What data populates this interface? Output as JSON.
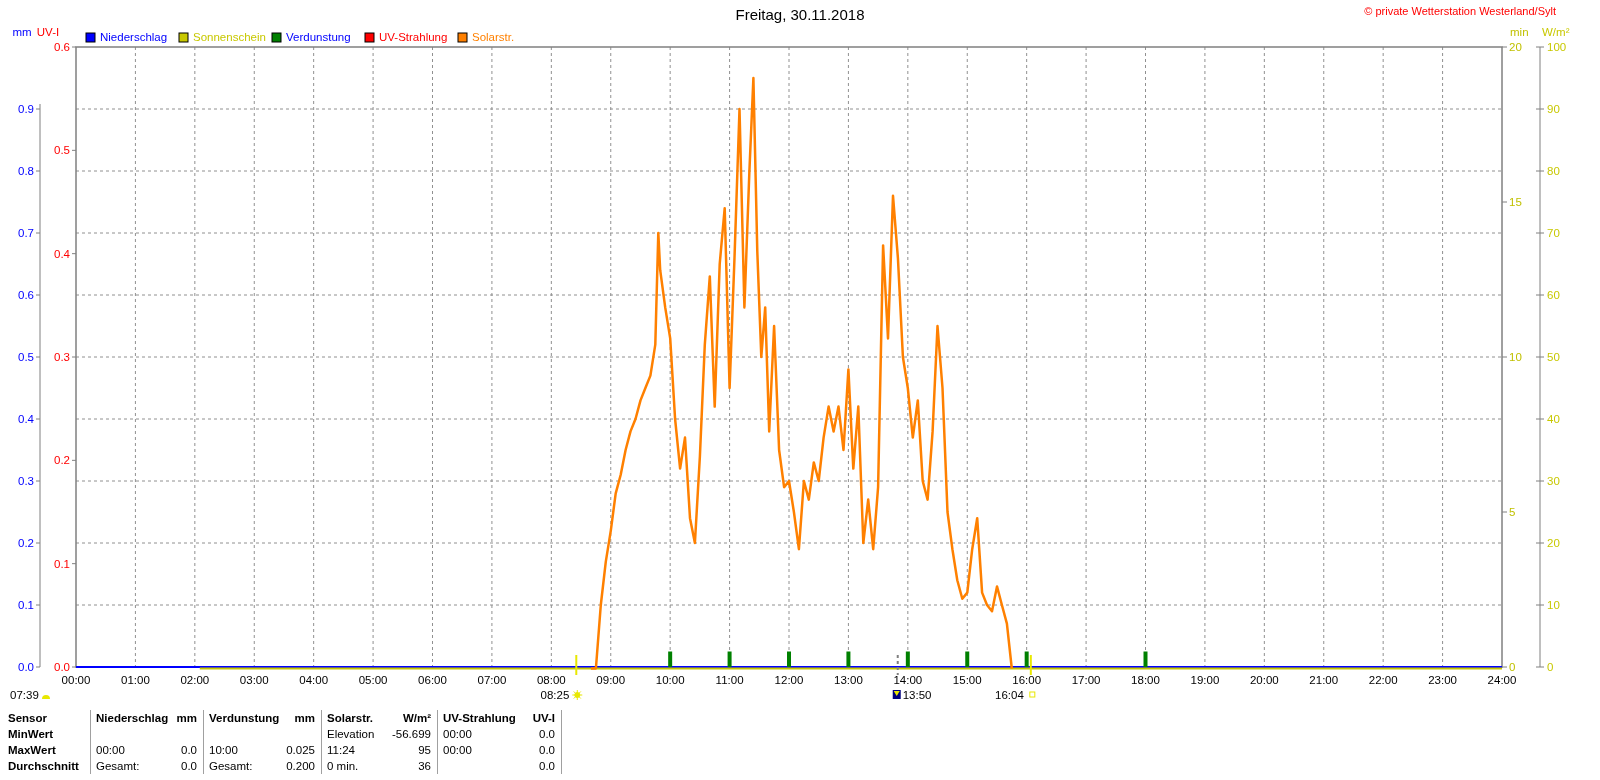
{
  "chart": {
    "copyright": "© private Wetterstation Westerland/Sylt",
    "axes": [
      {
        "title": "UV-I",
        "color": "#ff0000",
        "ticks": [
          "0.6",
          "0.5",
          "0.4",
          "0.3",
          "0.2",
          "0.1",
          "0.0"
        ]
      },
      {
        "title": "min",
        "color": "#c0c000",
        "ticks": [
          "20",
          "15",
          "10",
          "5",
          "0"
        ]
      }
    ],
    "chart_data": {
      "type": "line",
      "title": "Freitag, 30.11.2018",
      "grid": true,
      "legend": "top",
      "ylabel": "W/m²",
      "y2label": "mm",
      "y2lim": [
        0,
        1
      ],
      "y2ticks": [
        {
          "value": 0,
          "label": "0.0"
        },
        {
          "value": 0.1,
          "label": "0.1"
        },
        {
          "value": 0.2,
          "label": "0.2"
        },
        {
          "value": 0.3,
          "label": "0.3"
        },
        {
          "value": 0.4,
          "label": "0.4"
        },
        {
          "value": 0.5,
          "label": "0.5"
        },
        {
          "value": 0.6,
          "label": "0.6"
        },
        {
          "value": 0.7,
          "label": "0.7"
        },
        {
          "value": 0.8,
          "label": "0.8"
        },
        {
          "value": 0.9,
          "label": "0.9"
        }
      ],
      "xlim": [
        0,
        24
      ],
      "ylim": [
        0,
        100
      ],
      "yticks": [
        0,
        10,
        20,
        30,
        40,
        50,
        60,
        70,
        80,
        90,
        100
      ],
      "xticks": [
        {
          "value": 0,
          "label": "00:00"
        },
        {
          "value": 1,
          "label": "01:00"
        },
        {
          "value": 2,
          "label": "02:00"
        },
        {
          "value": 3,
          "label": "03:00"
        },
        {
          "value": 4,
          "label": "04:00"
        },
        {
          "value": 5,
          "label": "05:00"
        },
        {
          "value": 6,
          "label": "06:00"
        },
        {
          "value": 7,
          "label": "07:00"
        },
        {
          "value": 8,
          "label": "08:00"
        },
        {
          "value": 9,
          "label": "09:00"
        },
        {
          "value": 10,
          "label": "10:00"
        },
        {
          "value": 11,
          "label": "11:00"
        },
        {
          "value": 12,
          "label": "12:00"
        },
        {
          "value": 13,
          "label": "13:00"
        },
        {
          "value": 14,
          "label": "14:00"
        },
        {
          "value": 15,
          "label": "15:00"
        },
        {
          "value": 16,
          "label": "16:00"
        },
        {
          "value": 17,
          "label": "17:00"
        },
        {
          "value": 18,
          "label": "18:00"
        },
        {
          "value": 19,
          "label": "19:00"
        },
        {
          "value": 20,
          "label": "20:00"
        },
        {
          "value": 21,
          "label": "21:00"
        },
        {
          "value": 22,
          "label": "22:00"
        },
        {
          "value": 23,
          "label": "23:00"
        },
        {
          "value": 24,
          "label": "24:00"
        }
      ],
      "x": [
        0,
        2.083,
        8.667,
        8.75,
        8.833,
        8.917,
        9,
        9.083,
        9.167,
        9.25,
        9.333,
        9.417,
        9.5,
        9.583,
        9.667,
        9.75,
        9.8,
        9.833,
        9.917,
        10,
        10.083,
        10.167,
        10.25,
        10.333,
        10.417,
        10.5,
        10.583,
        10.667,
        10.75,
        10.833,
        10.917,
        11,
        11.083,
        11.167,
        11.25,
        11.333,
        11.4,
        11.467,
        11.533,
        11.6,
        11.667,
        11.75,
        11.833,
        11.917,
        12,
        12.083,
        12.167,
        12.25,
        12.333,
        12.417,
        12.5,
        12.583,
        12.667,
        12.75,
        12.833,
        12.917,
        13,
        13.083,
        13.167,
        13.25,
        13.333,
        13.417,
        13.5,
        13.583,
        13.667,
        13.75,
        13.833,
        13.917,
        14,
        14.083,
        14.167,
        14.25,
        14.333,
        14.417,
        14.5,
        14.583,
        14.667,
        14.75,
        14.833,
        14.917,
        15,
        15.083,
        15.167,
        15.25,
        15.333,
        15.417,
        15.5,
        15.583,
        15.667,
        15.75,
        16,
        18,
        24
      ],
      "series": [
        {
          "name": "Niederschlag",
          "color": "#0000ff",
          "axis": "y2",
          "values": [
            0,
            0,
            0,
            0,
            0,
            0,
            0,
            0,
            0,
            0,
            0,
            0,
            0,
            0,
            0,
            0,
            0,
            0,
            0,
            0,
            0,
            0,
            0,
            0,
            0,
            0,
            0,
            0,
            0,
            0,
            0,
            0,
            0,
            0,
            0,
            0,
            0,
            0,
            0,
            0,
            0,
            0,
            0,
            0,
            0,
            0,
            0,
            0,
            0,
            0,
            0,
            0,
            0,
            0,
            0,
            0,
            0,
            0,
            0,
            0,
            0,
            0,
            0,
            0,
            0,
            0,
            0,
            0,
            0,
            0,
            0,
            0,
            0,
            0,
            0,
            0,
            0,
            0,
            0,
            0,
            0,
            0,
            0,
            0,
            0,
            0,
            0,
            0,
            0,
            0,
            0,
            0,
            0
          ]
        },
        {
          "name": "Sonnenschein",
          "color": "#c8c800",
          "values": [
            null,
            0,
            0,
            0,
            0,
            0,
            0,
            0,
            0,
            0,
            0,
            0,
            0,
            0,
            0,
            0,
            0,
            0,
            0,
            0,
            0,
            0,
            0,
            0,
            0,
            0,
            0,
            0,
            0,
            0,
            0,
            0,
            0,
            0,
            0,
            0,
            0,
            0,
            0,
            0,
            0,
            0,
            0,
            0,
            0,
            0,
            0,
            0,
            0,
            0,
            0,
            0,
            0,
            0,
            0,
            0,
            0,
            0,
            0,
            0,
            0,
            0,
            0,
            0,
            0,
            0,
            0,
            0,
            0,
            0,
            0,
            0,
            0,
            0,
            0,
            0,
            0,
            0,
            0,
            0,
            0,
            0,
            0,
            0,
            0,
            0,
            0,
            0,
            0,
            0,
            0,
            0,
            0
          ]
        },
        {
          "name": "Verdunstung",
          "color": "#008000",
          "type": "bar",
          "axis": "y2",
          "values": [
            null,
            null,
            null,
            null,
            null,
            null,
            null,
            null,
            null,
            null,
            null,
            null,
            null,
            null,
            null,
            null,
            null,
            null,
            null,
            0.025,
            null,
            null,
            null,
            null,
            null,
            null,
            null,
            null,
            null,
            null,
            null,
            0.025,
            null,
            null,
            null,
            null,
            null,
            null,
            null,
            null,
            null,
            null,
            null,
            null,
            0.025,
            null,
            null,
            null,
            null,
            null,
            null,
            null,
            null,
            null,
            null,
            null,
            0.025,
            null,
            null,
            null,
            null,
            null,
            null,
            null,
            null,
            null,
            null,
            null,
            0.025,
            null,
            null,
            null,
            null,
            null,
            null,
            null,
            null,
            null,
            null,
            null,
            0.025,
            null,
            null,
            null,
            null,
            null,
            null,
            null,
            null,
            null,
            0.025,
            0.025,
            null
          ]
        },
        {
          "name": "UV-Strahlung",
          "color": "#ff0000",
          "values": [
            null,
            null,
            null,
            null,
            null,
            null,
            null,
            null,
            null,
            null,
            null,
            null,
            null,
            null,
            null,
            null,
            null,
            null,
            null,
            null,
            null,
            null,
            null,
            null,
            null,
            null,
            null,
            null,
            null,
            null,
            null,
            null,
            null,
            null,
            null,
            null,
            null,
            null,
            null,
            null,
            null,
            null,
            null,
            null,
            null,
            null,
            null,
            null,
            null,
            null,
            null,
            null,
            null,
            null,
            null,
            null,
            null,
            null,
            null,
            null,
            null,
            null,
            null,
            null,
            null,
            null,
            null,
            null,
            null,
            null,
            null,
            null,
            null,
            null,
            null,
            null,
            null,
            null,
            null,
            null,
            null,
            null,
            null,
            null,
            null,
            null,
            null,
            null,
            null,
            null,
            null,
            null,
            null
          ]
        },
        {
          "name": "Solarstr.",
          "color": "#ff8000",
          "values": [
            null,
            null,
            0,
            0,
            10,
            17,
            22,
            28,
            31,
            35,
            38,
            40,
            43,
            45,
            47,
            52,
            70,
            64,
            58,
            53,
            40,
            32,
            37,
            24,
            20,
            34,
            52,
            63,
            42,
            65,
            74,
            45,
            66,
            90,
            58,
            80,
            95,
            67,
            50,
            58,
            38,
            55,
            35,
            29,
            30,
            25,
            19,
            30,
            27,
            33,
            30,
            37,
            42,
            38,
            42,
            35,
            48,
            32,
            42,
            20,
            27,
            19,
            29,
            68,
            53,
            76,
            66,
            50,
            45,
            37,
            43,
            30,
            27,
            38,
            55,
            45,
            25,
            19,
            14,
            11,
            12,
            19,
            24,
            12,
            10,
            9,
            13,
            10,
            7,
            0,
            null,
            null,
            null
          ]
        }
      ],
      "annotations": [
        "07:39",
        "08:25",
        "13:50",
        "16:04"
      ]
    }
  },
  "table": {
    "header": "Sensor",
    "columns": [
      {
        "label": "Niederschlag",
        "unit": "mm"
      },
      {
        "label": "Verdunstung",
        "unit": "mm"
      },
      {
        "label": "Solarstr.",
        "unit": "W/m²"
      },
      {
        "label": "UV-Strahlung",
        "unit": "UV-I"
      }
    ],
    "rows": [
      {
        "label": "MinWert",
        "cells": [
          {},
          {},
          {
            "note": "Elevation",
            "value": "-56.699"
          },
          {
            "note": "00:00",
            "value": "0.0"
          }
        ]
      },
      {
        "label": "MaxWert",
        "cells": [
          {
            "note": "00:00",
            "value": "0.0"
          },
          {
            "note": "10:00",
            "value": "0.025"
          },
          {
            "note": "11:24",
            "value": "95"
          },
          {
            "note": "00:00",
            "value": "0.0"
          }
        ]
      },
      {
        "label": "Durchschnitt",
        "cells": [
          {
            "note": "Gesamt:",
            "value": "0.0"
          },
          {
            "note": "Gesamt:",
            "value": "0.200"
          },
          {
            "note": "0 min.",
            "value": "36"
          },
          {
            "value": "0.0"
          }
        ]
      }
    ]
  }
}
